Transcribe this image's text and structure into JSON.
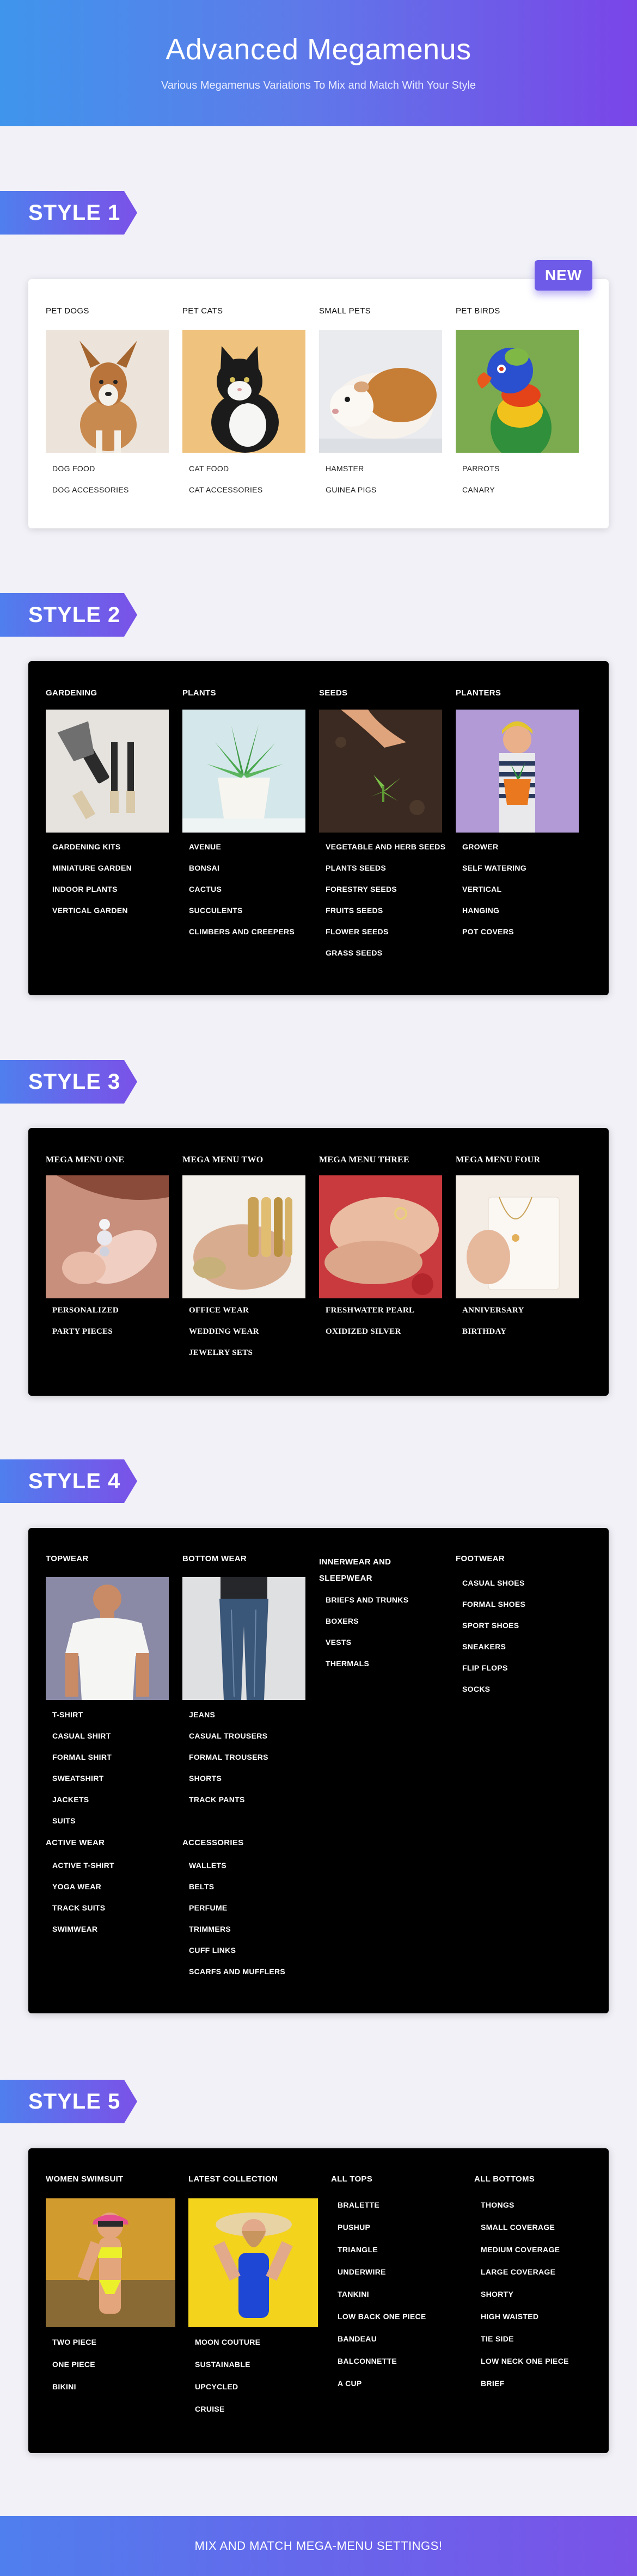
{
  "hero": {
    "title": "Advanced Megamenus",
    "subtitle": "Various Megamenus Variations To Mix and Match With Your Style"
  },
  "style1": {
    "tag": "STYLE 1",
    "badge": "NEW",
    "columns": [
      {
        "title": "PET DOGS",
        "items": [
          "DOG FOOD",
          "DOG ACCESSORIES"
        ]
      },
      {
        "title": "PET CATS",
        "items": [
          "CAT FOOD",
          "CAT ACCESSORIES"
        ]
      },
      {
        "title": "SMALL PETS",
        "items": [
          "HAMSTER",
          "GUINEA PIGS"
        ]
      },
      {
        "title": "PET BIRDS",
        "items": [
          "PARROTS",
          "CANARY"
        ]
      }
    ]
  },
  "style2": {
    "tag": "STYLE 2",
    "columns": [
      {
        "title": "GARDENING",
        "items": [
          "GARDENING KITS",
          "MINIATURE GARDEN",
          "INDOOR PLANTS",
          "VERTICAL GARDEN"
        ]
      },
      {
        "title": "PLANTS",
        "items": [
          "AVENUE",
          "BONSAI",
          "CACTUS",
          "SUCCULENTS",
          "CLIMBERS AND CREEPERS"
        ]
      },
      {
        "title": "SEEDS",
        "items": [
          "VEGETABLE AND HERB SEEDS",
          "PLANTS SEEDS",
          "FORESTRY SEEDS",
          "FRUITS SEEDS",
          "FLOWER SEEDS",
          "GRASS SEEDS"
        ]
      },
      {
        "title": "PLANTERS",
        "items": [
          "GROWER",
          "SELF WATERING",
          "VERTICAL",
          "HANGING",
          "POT COVERS"
        ]
      }
    ]
  },
  "style3": {
    "tag": "STYLE 3",
    "columns": [
      {
        "title": "MEGA MENU ONE",
        "items": [
          "PERSONALIZED",
          "PARTY PIECES"
        ]
      },
      {
        "title": "MEGA MENU TWO",
        "items": [
          "OFFICE WEAR",
          "WEDDING WEAR",
          "JEWELRY SETS"
        ]
      },
      {
        "title": "MEGA MENU THREE",
        "items": [
          "FRESHWATER PEARL",
          "OXIDIZED SILVER"
        ]
      },
      {
        "title": "MEGA MENU FOUR",
        "items": [
          "ANNIVERSARY",
          "BIRTHDAY"
        ]
      }
    ]
  },
  "style4": {
    "tag": "STYLE 4",
    "topwear": {
      "title": "TOPWEAR",
      "items": [
        "T-SHIRT",
        "CASUAL SHIRT",
        "FORMAL SHIRT",
        "SWEATSHIRT",
        "JACKETS",
        "SUITS"
      ]
    },
    "bottomwear": {
      "title": "BOTTOM WEAR",
      "items": [
        "JEANS",
        "CASUAL TROUSERS",
        "FORMAL TROUSERS",
        "SHORTS",
        "TRACK PANTS"
      ]
    },
    "innerwear": {
      "title_line1": "INNERWEAR AND",
      "title_line2": "SLEEPWEAR",
      "items": [
        "BRIEFS AND TRUNKS",
        "BOXERS",
        "VESTS",
        "THERMALS"
      ]
    },
    "footwear": {
      "title": "FOOTWEAR",
      "items": [
        "CASUAL SHOES",
        "FORMAL SHOES",
        "SPORT SHOES",
        "SNEAKERS",
        "FLIP FLOPS",
        "SOCKS"
      ]
    },
    "activewear": {
      "title": "ACTIVE WEAR",
      "items": [
        "ACTIVE T-SHIRT",
        "YOGA WEAR",
        "TRACK SUITS",
        "SWIMWEAR"
      ]
    },
    "accessories": {
      "title": "ACCESSORIES",
      "items": [
        "WALLETS",
        "BELTS",
        "PERFUME",
        "TRIMMERS",
        "CUFF LINKS",
        "SCARFS AND MUFFLERS"
      ]
    }
  },
  "style5": {
    "tag": "STYLE 5",
    "columns": [
      {
        "title": "WOMEN SWIMSUIT",
        "items": [
          "TWO PIECE",
          "ONE PIECE",
          "BIKINI"
        ]
      },
      {
        "title": "LATEST COLLECTION",
        "items": [
          "MOON COUTURE",
          "SUSTAINABLE",
          "UPCYCLED",
          "CRUISE"
        ]
      },
      {
        "title": "ALL TOPS",
        "items": [
          "BRALETTE",
          "PUSHUP",
          "TRIANGLE",
          "UNDERWIRE",
          "TANKINI",
          "LOW BACK ONE PIECE",
          "BANDEAU",
          "BALCONNETTE",
          "A CUP"
        ]
      },
      {
        "title": "ALL BOTTOMS",
        "items": [
          "THONGS",
          "SMALL COVERAGE",
          "MEDIUM COVERAGE",
          "LARGE COVERAGE",
          "SHORTY",
          "HIGH WAISTED",
          "TIE SIDE",
          "LOW NECK ONE PIECE",
          "BRIEF"
        ]
      }
    ]
  },
  "footer": {
    "text": "MIX AND MATCH MEGA-MENU SETTINGS!"
  }
}
